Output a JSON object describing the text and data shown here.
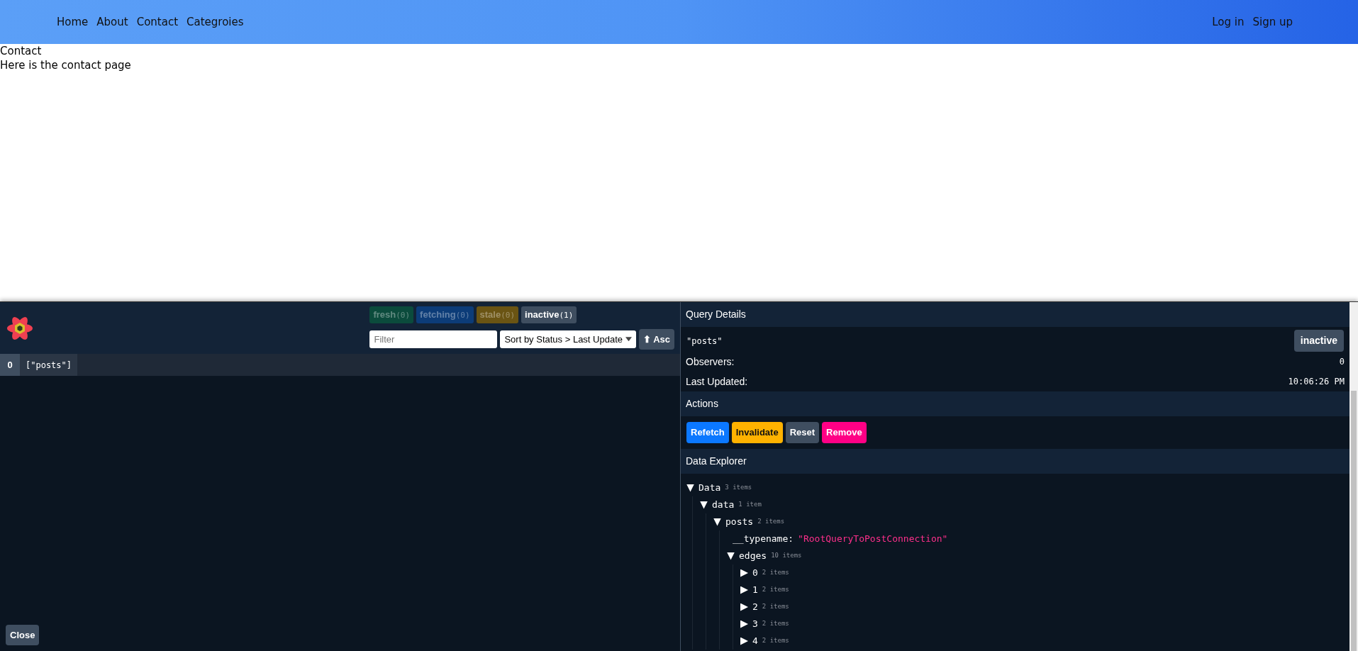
{
  "navbar": {
    "links": [
      {
        "label": "Home"
      },
      {
        "label": "About"
      },
      {
        "label": "Contact"
      },
      {
        "label": "Categroies"
      }
    ],
    "auth_links": [
      {
        "label": "Log in"
      },
      {
        "label": "Sign up"
      }
    ]
  },
  "page": {
    "heading": "Contact",
    "text": "Here is the contact page"
  },
  "devtools": {
    "status_badges": [
      {
        "label": "fresh",
        "count": "(0)",
        "color": "#0b4b3c",
        "disabled": true
      },
      {
        "label": "fetching",
        "count": "(0)",
        "color": "#0c3c78",
        "disabled": true
      },
      {
        "label": "stale",
        "count": "(0)",
        "color": "#6a5413",
        "disabled": true
      },
      {
        "label": "inactive",
        "count": "(1)",
        "color": "#3f4e60",
        "disabled": false
      }
    ],
    "filter": {
      "placeholder": "Filter"
    },
    "sort": {
      "value": "Sort by Status > Last Update"
    },
    "order_button": "⬆ Asc",
    "queries": [
      {
        "observers": "0",
        "key": "[\"posts\"]",
        "selected": true
      }
    ],
    "close_button": "Close",
    "details": {
      "header": "Query Details",
      "query_key": "\"posts\"",
      "status": "inactive",
      "rows": [
        {
          "label": "Observers:",
          "value": "0"
        },
        {
          "label": "Last Updated:",
          "value": "10:06:26 PM"
        }
      ]
    },
    "actions": {
      "header": "Actions",
      "buttons": [
        {
          "label": "Refetch",
          "color": "#0b78ff"
        },
        {
          "label": "Invalidate",
          "color": "#ffb200"
        },
        {
          "label": "Reset",
          "color": "#3f4e60"
        },
        {
          "label": "Remove",
          "color": "#ff0085"
        }
      ]
    },
    "explorer": {
      "header": "Data Explorer",
      "tree": [
        {
          "label": "Data",
          "count": "3 items",
          "expanded": true,
          "children": [
            {
              "label": "data",
              "count": "1 item",
              "expanded": true,
              "children": [
                {
                  "label": "posts",
                  "count": "2 items",
                  "expanded": true,
                  "children": [
                    {
                      "kind": "value",
                      "key": "__typename:",
                      "value": "\"RootQueryToPostConnection\""
                    },
                    {
                      "label": "edges",
                      "count": "10 items",
                      "expanded": true,
                      "children": [
                        {
                          "label": "0",
                          "count": "2 items",
                          "expanded": false
                        },
                        {
                          "label": "1",
                          "count": "2 items",
                          "expanded": false
                        },
                        {
                          "label": "2",
                          "count": "2 items",
                          "expanded": false
                        },
                        {
                          "label": "3",
                          "count": "2 items",
                          "expanded": false
                        },
                        {
                          "label": "4",
                          "count": "2 items",
                          "expanded": false
                        }
                      ]
                    }
                  ]
                }
              ]
            }
          ]
        }
      ]
    }
  }
}
